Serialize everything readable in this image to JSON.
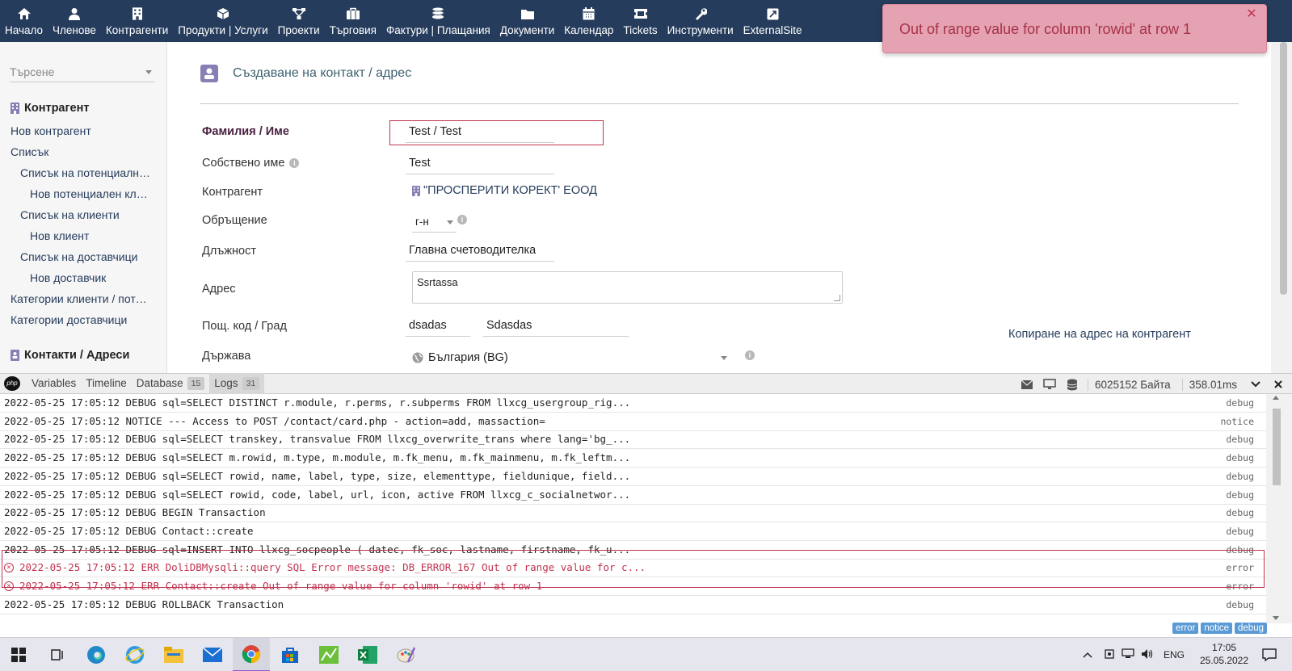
{
  "topnav": {
    "items": [
      {
        "label": "Начало",
        "icon": "home-icon"
      },
      {
        "label": "Членове",
        "icon": "user-icon"
      },
      {
        "label": "Контрагенти",
        "icon": "building-icon"
      },
      {
        "label": "Продукти | Услуги",
        "icon": "cube-icon"
      },
      {
        "label": "Проекти",
        "icon": "project-icon"
      },
      {
        "label": "Търговия",
        "icon": "briefcase-icon"
      },
      {
        "label": "Фактури | Плащания",
        "icon": "coins-icon"
      },
      {
        "label": "Документи",
        "icon": "folder-icon"
      },
      {
        "label": "Календар",
        "icon": "calendar-icon"
      },
      {
        "label": "Tickets",
        "icon": "ticket-icon"
      },
      {
        "label": "Инструменти",
        "icon": "wrench-icon"
      },
      {
        "label": "ExternalSite",
        "icon": "external-icon"
      }
    ]
  },
  "toast": {
    "message": "Out of range value for column 'rowid' at row 1"
  },
  "sidebar": {
    "search_placeholder": "Търсене",
    "section1": "Контрагент",
    "links1": [
      {
        "label": "Нов контрагент",
        "indent": 0
      },
      {
        "label": "Списък",
        "indent": 0
      },
      {
        "label": "Списък на потенциалн…",
        "indent": 1
      },
      {
        "label": "Нов потенциален кл…",
        "indent": 2
      },
      {
        "label": "Списък на клиенти",
        "indent": 1
      },
      {
        "label": "Нов клиент",
        "indent": 2
      },
      {
        "label": "Списък на доставчици",
        "indent": 1
      },
      {
        "label": "Нов доставчик",
        "indent": 2
      },
      {
        "label": "Категории клиенти / пот…",
        "indent": 0
      },
      {
        "label": "Категории доставчици",
        "indent": 0
      }
    ],
    "section2": "Контакти / Адреси"
  },
  "form": {
    "title": "Създаване на контакт / адрес",
    "lastname_label": "Фамилия / Име",
    "lastname_value": "Test / Test",
    "firstname_label": "Собствено име",
    "firstname_value": "Test",
    "company_label": "Контрагент",
    "company_value": "\"ПРОСПЕРИТИ КОРЕКТ' ЕООД",
    "civility_label": "Обръщение",
    "civility_value": "г-н",
    "job_label": "Длъжност",
    "job_value": "Главна счетоводителка",
    "address_label": "Адрес",
    "address_value": "Ssrtassa",
    "zip_label": "Пощ. код / Град",
    "zip_value": "dsadas",
    "town_value": "Sdasdas",
    "copy_address": "Копиране на адрес на контрагент",
    "country_label": "Държава",
    "country_value": "България (BG)"
  },
  "debugbar": {
    "tabs": [
      {
        "label": "Variables"
      },
      {
        "label": "Timeline"
      },
      {
        "label": "Database",
        "badge": "15"
      },
      {
        "label": "Logs",
        "badge": "31"
      }
    ],
    "memory": "6025152 Байта",
    "time": "358.01ms"
  },
  "logs": [
    {
      "msg": "2022-05-25 17:05:12 DEBUG sql=SELECT DISTINCT r.module, r.perms, r.subperms FROM llxcg_usergroup_rig...",
      "level": "debug"
    },
    {
      "msg": "2022-05-25 17:05:12 NOTICE --- Access to POST /contact/card.php - action=add, massaction=",
      "level": "notice"
    },
    {
      "msg": "2022-05-25 17:05:12 DEBUG sql=SELECT transkey, transvalue FROM llxcg_overwrite_trans where lang='bg_...",
      "level": "debug"
    },
    {
      "msg": "2022-05-25 17:05:12 DEBUG sql=SELECT m.rowid, m.type, m.module, m.fk_menu, m.fk_mainmenu, m.fk_leftm...",
      "level": "debug"
    },
    {
      "msg": "2022-05-25 17:05:12 DEBUG sql=SELECT rowid, name, label, type, size, elementtype, fieldunique, field...",
      "level": "debug"
    },
    {
      "msg": "2022-05-25 17:05:12 DEBUG sql=SELECT rowid, code, label, url, icon, active FROM llxcg_c_socialnetwor...",
      "level": "debug"
    },
    {
      "msg": "2022-05-25 17:05:12 DEBUG BEGIN Transaction",
      "level": "debug"
    },
    {
      "msg": "2022-05-25 17:05:12 DEBUG Contact::create",
      "level": "debug"
    },
    {
      "msg": "2022-05-25 17:05:12 DEBUG sql=INSERT INTO llxcg_socpeople ( datec, fk_soc, lastname, firstname, fk_u...",
      "level": "debug"
    },
    {
      "msg": "2022-05-25 17:05:12 ERR DoliDBMysqli::query SQL Error message: DB_ERROR_167 Out of range value for c...",
      "level": "error"
    },
    {
      "msg": "2022-05-25 17:05:12 ERR Contact::create Out of range value for column 'rowid' at row 1",
      "level": "error"
    },
    {
      "msg": "2022-05-25 17:05:12 DEBUG ROLLBACK Transaction",
      "level": "debug"
    }
  ],
  "filters": [
    "error",
    "notice",
    "debug"
  ],
  "taskbar": {
    "lang": "ENG",
    "time": "17:05",
    "date": "25.05.2022"
  }
}
